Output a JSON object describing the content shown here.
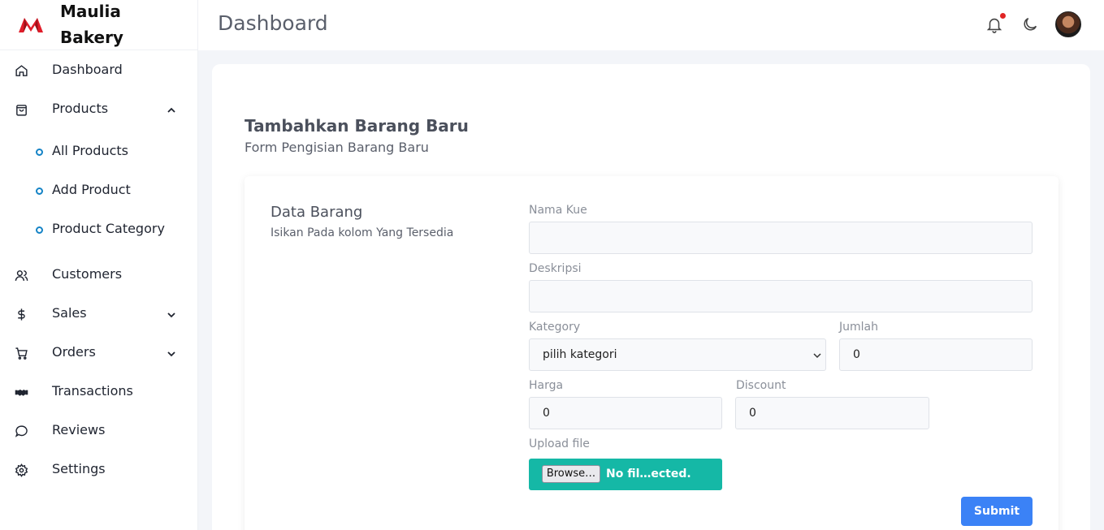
{
  "brand": {
    "name": "Maulia Bakery",
    "logo_icon": "bakery-logo-icon",
    "logo_color": "#e11d2a"
  },
  "header": {
    "title": "Dashboard",
    "notification_dot_color": "#e02424"
  },
  "sidebar": {
    "items": [
      {
        "label": "Dashboard",
        "icon": "home-icon"
      },
      {
        "label": "Products",
        "icon": "shopping-bag-icon",
        "expanded": true,
        "children": [
          {
            "label": "All Products"
          },
          {
            "label": "Add Product"
          },
          {
            "label": "Product Category"
          }
        ]
      },
      {
        "label": "Customers",
        "icon": "users-icon"
      },
      {
        "label": "Sales",
        "icon": "dollar-icon"
      },
      {
        "label": "Orders",
        "icon": "cart-icon"
      },
      {
        "label": "Transactions",
        "icon": "handshake-icon"
      },
      {
        "label": "Reviews",
        "icon": "chat-bubble-icon"
      },
      {
        "label": "Settings",
        "icon": "gear-icon"
      }
    ]
  },
  "form": {
    "title": "Tambahkan Barang Baru",
    "subtitle": "Form Pengisian Barang Baru",
    "section_title": "Data Barang",
    "section_desc": "Isikan Pada kolom Yang Tersedia",
    "fields": {
      "nama_kue": {
        "label": "Nama Kue",
        "value": ""
      },
      "deskripsi": {
        "label": "Deskripsi",
        "value": ""
      },
      "kategori": {
        "label": "Kategory",
        "selected": "pilih kategori"
      },
      "jumlah": {
        "label": "Jumlah",
        "value": "0"
      },
      "harga": {
        "label": "Harga",
        "value": "0"
      },
      "discount": {
        "label": "Discount",
        "value": "0"
      },
      "upload": {
        "label": "Upload file",
        "browse_label": "Browse…",
        "status": "No fil…ected."
      }
    },
    "submit_label": "Submit"
  },
  "colors": {
    "accent": "#3b82f6",
    "upload_bg": "#15b8a6",
    "subnav_dot": "#1483c6"
  }
}
